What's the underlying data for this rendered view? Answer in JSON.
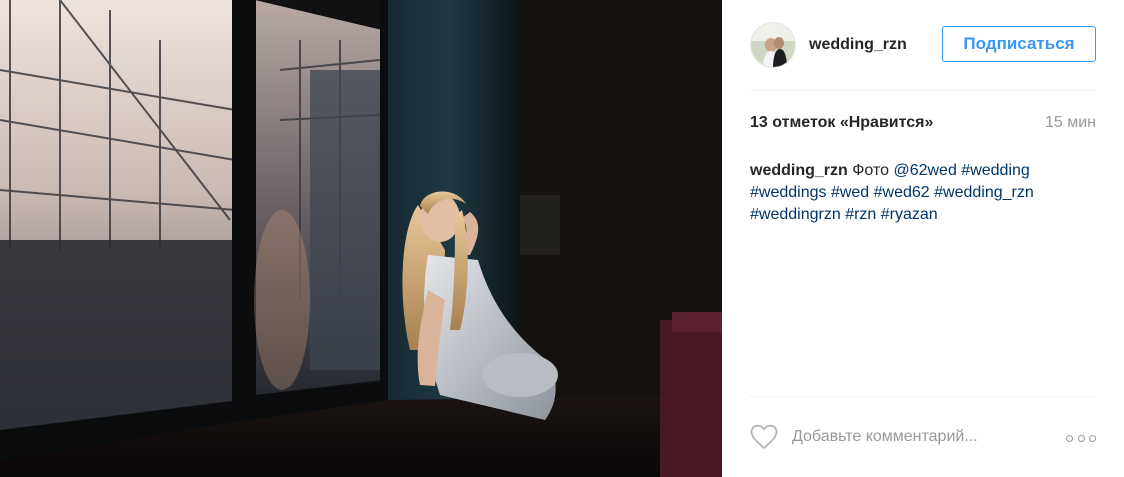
{
  "post": {
    "username": "wedding_rzn",
    "follow_label": "Подписаться",
    "likes_text": "13 отметок «Нравится»",
    "time_ago": "15 мин",
    "caption": {
      "username": "wedding_rzn",
      "text": "Фото",
      "mention": "@62wed",
      "hashtags": [
        "#wedding",
        "#weddings",
        "#wed",
        "#wed62",
        "#wedding_rzn",
        "#weddingrzn",
        "#rzn",
        "#ryazan"
      ]
    },
    "comment_placeholder": "Добавьте комментарий...",
    "icons": {
      "like": "heart-icon",
      "options": "more-options-icon",
      "avatar": "avatar"
    }
  },
  "colors": {
    "accent": "#3897f0",
    "hashtag": "#003569",
    "muted": "#999999",
    "text": "#262626",
    "divider": "#efefef"
  }
}
